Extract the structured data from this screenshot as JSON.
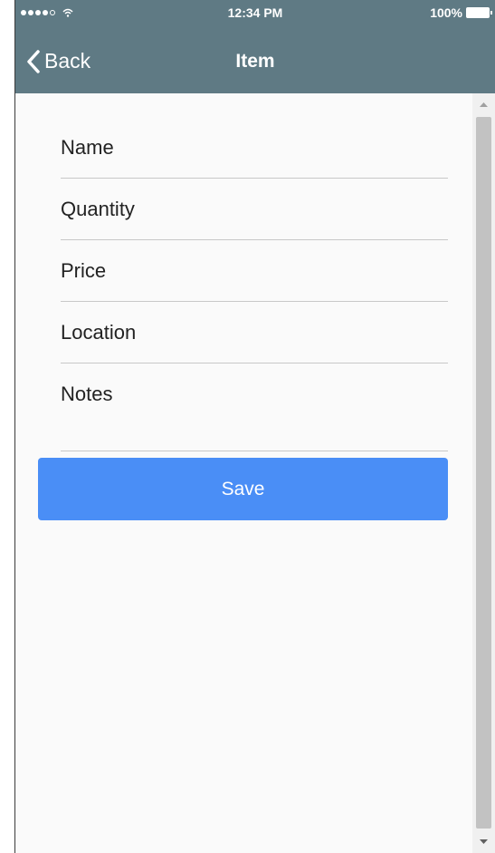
{
  "status_bar": {
    "time": "12:34 PM",
    "battery": "100%",
    "signal_icon": "signal-dots-icon",
    "wifi_icon": "wifi-icon",
    "battery_icon": "battery-icon"
  },
  "nav": {
    "back_label": "Back",
    "back_icon": "chevron-left-icon",
    "title": "Item"
  },
  "form": {
    "fields": [
      {
        "label": "Name"
      },
      {
        "label": "Quantity"
      },
      {
        "label": "Price"
      },
      {
        "label": "Location"
      },
      {
        "label": "Notes"
      }
    ],
    "save_label": "Save"
  },
  "colors": {
    "header_bg": "#5f7a84",
    "save_button": "#4a8ef6"
  }
}
